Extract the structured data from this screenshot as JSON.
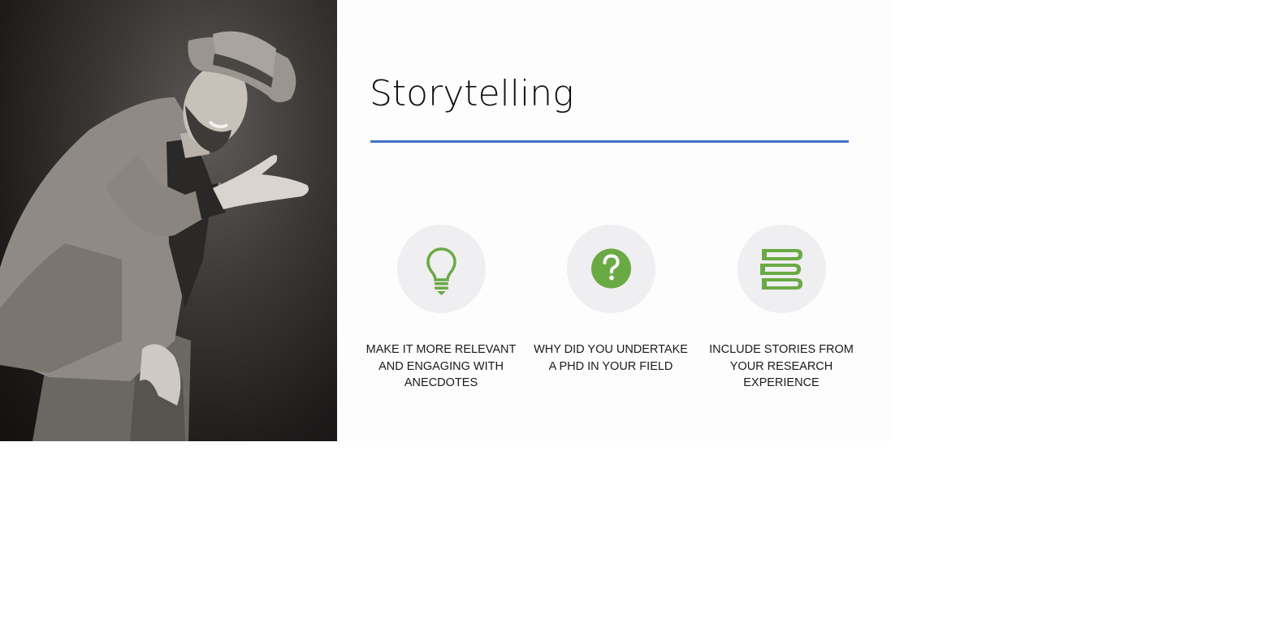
{
  "slide": {
    "title": "Storytelling",
    "accent_color": "#4472c4",
    "icon_color": "#6aaa45",
    "photo": {
      "subject": "man-in-hat-gesturing-photo"
    },
    "features": [
      {
        "icon": "lightbulb-icon",
        "caption": "MAKE IT MORE RELEVANT AND ENGAGING WITH ANECDOTES"
      },
      {
        "icon": "question-mark-icon",
        "caption": "WHY DID YOU UNDERTAKE A PHD IN YOUR FIELD"
      },
      {
        "icon": "books-icon",
        "caption": "INCLUDE STORIES FROM YOUR RESEARCH EXPERIENCE"
      }
    ]
  }
}
